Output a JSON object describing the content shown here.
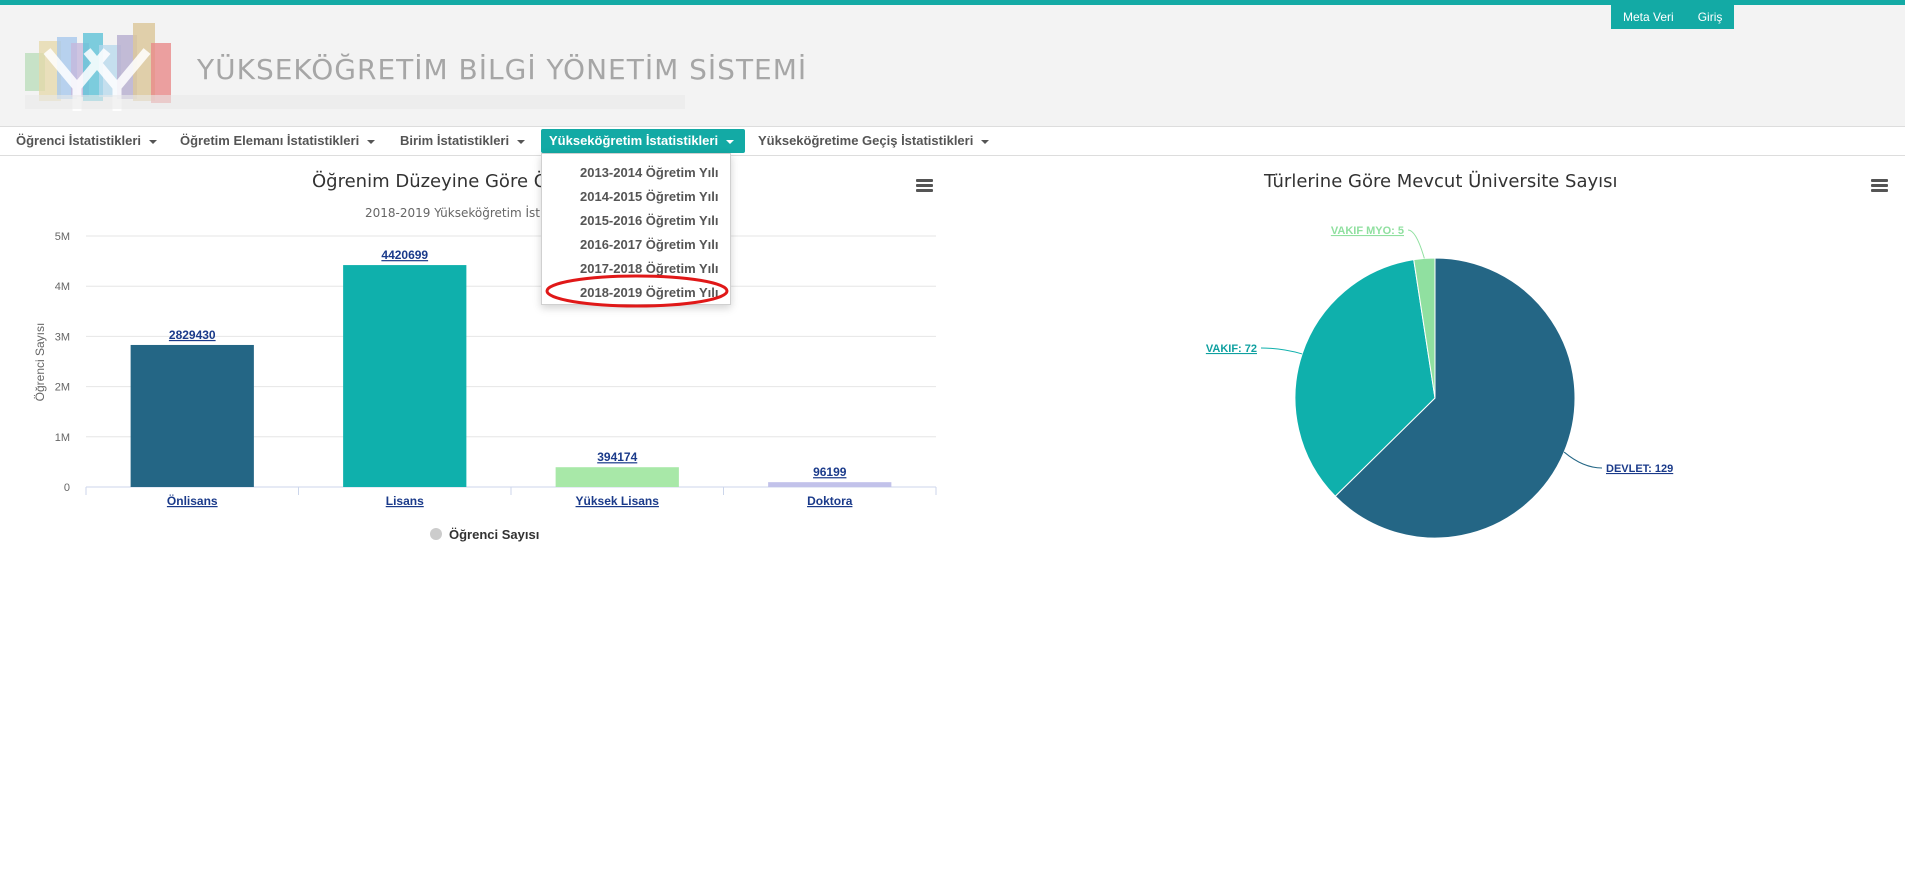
{
  "header": {
    "title": "YÜKSEKÖĞRETİM BİLGİ YÖNETİM SİSTEMİ",
    "links": [
      "Meta Veri",
      "Giriş"
    ]
  },
  "nav": {
    "items": [
      {
        "label": "Öğrenci İstatistikleri"
      },
      {
        "label": "Öğretim Elemanı İstatistikleri"
      },
      {
        "label": "Birim İstatistikleri"
      },
      {
        "label": "Yükseköğretim İstatistikleri"
      },
      {
        "label": "Yükseköğretime Geçiş İstatistikleri"
      }
    ],
    "active_index": 3
  },
  "dropdown": {
    "items": [
      "2013-2014 Öğretim Yılı",
      "2014-2015 Öğretim Yılı",
      "2015-2016 Öğretim Yılı",
      "2016-2017 Öğretim Yılı",
      "2017-2018 Öğretim Yılı",
      "2018-2019 Öğretim Yılı"
    ],
    "highlighted_index": 5
  },
  "chart_data": [
    {
      "type": "bar",
      "title": "Öğrenim Düzeyine Göre Ö",
      "subtitle": "2018-2019 Yükseköğretim İst",
      "categories": [
        "Önlisans",
        "Lisans",
        "Yüksek Lisans",
        "Doktora"
      ],
      "values": [
        2829430,
        4420699,
        394174,
        96199
      ],
      "colors": [
        "#246685",
        "#0fb0ac",
        "#a8e8a8",
        "#c2c2ea"
      ],
      "ylabel": "Öğrenci Sayısı",
      "yticks": [
        "0",
        "1M",
        "2M",
        "3M",
        "4M",
        "5M"
      ],
      "ylim": [
        0,
        5000000
      ],
      "legend": "Öğrenci Sayısı",
      "legend_position": "bottom-center",
      "grid": true
    },
    {
      "type": "pie",
      "title": "Türlerine Göre Mevcut Üniversite Sayısı",
      "labels": [
        "DEVLET",
        "VAKIF",
        "VAKIF MYO"
      ],
      "values": [
        129,
        72,
        5
      ],
      "colors": [
        "#246685",
        "#0fb0ac",
        "#90e0a0"
      ],
      "data_labels": [
        "DEVLET: 129",
        "VAKIF: 72",
        "VAKIF MYO: 5"
      ]
    }
  ]
}
